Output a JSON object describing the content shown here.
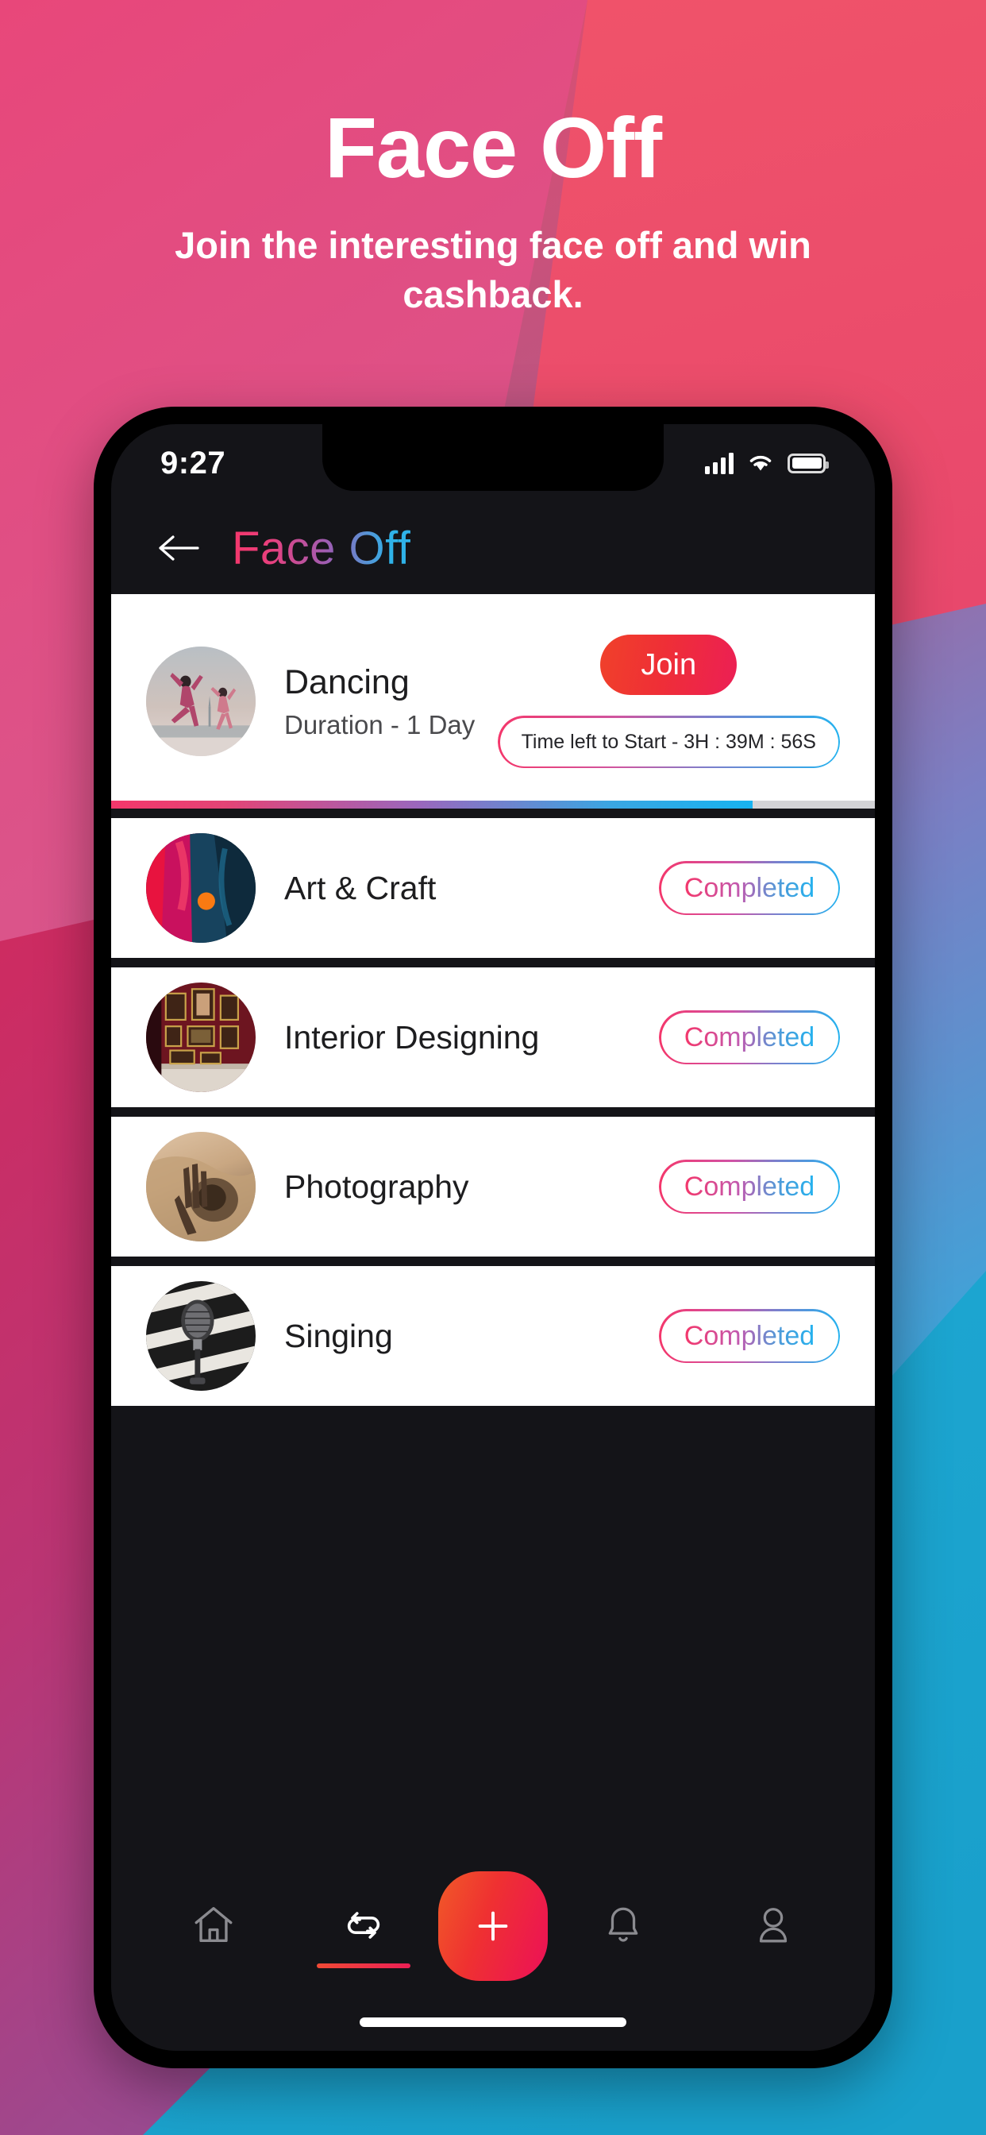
{
  "promo": {
    "title": "Face Off",
    "subtitle": "Join the interesting face off and win cashback."
  },
  "colors": {
    "accent_pink": "#f4376b",
    "accent_cyan": "#23b2ef",
    "join_red": "#ec1f55",
    "bg_pink": "#e8456f",
    "bg_crimson": "#cf2d5f",
    "bg_purple": "#9b4a90",
    "bg_cyan": "#1ba0cc"
  },
  "status_bar": {
    "time": "9:27",
    "signal_icon": "signal-bars-icon",
    "wifi_icon": "wifi-icon",
    "battery_icon": "battery-icon"
  },
  "nav": {
    "back_icon": "back-arrow-icon",
    "title_part_1": "Face",
    "title_part_2": "Off",
    "title": "Face Off"
  },
  "featured": {
    "title": "Dancing",
    "subtitle": "Duration - 1 Day",
    "join_label": "Join",
    "timer_label": "Time left to Start - 3H : 39M : 56S",
    "progress_percent": 84,
    "avatar_icon": "dancing-avatar"
  },
  "items": [
    {
      "title": "Art & Craft",
      "status": "Completed",
      "avatar_icon": "art-craft-avatar"
    },
    {
      "title": "Interior Designing",
      "status": "Completed",
      "avatar_icon": "interior-design-avatar"
    },
    {
      "title": "Photography",
      "status": "Completed",
      "avatar_icon": "photography-avatar"
    },
    {
      "title": "Singing",
      "status": "Completed",
      "avatar_icon": "singing-avatar"
    }
  ],
  "tabbar": {
    "tabs": [
      {
        "name": "home",
        "icon": "home-icon",
        "active": false
      },
      {
        "name": "face-off",
        "icon": "swap-icon",
        "active": true
      },
      {
        "name": "add",
        "icon": "plus-icon",
        "active": false
      },
      {
        "name": "notifications",
        "icon": "bell-icon",
        "active": false
      },
      {
        "name": "profile",
        "icon": "person-icon",
        "active": false
      }
    ],
    "fab_label": "+"
  }
}
